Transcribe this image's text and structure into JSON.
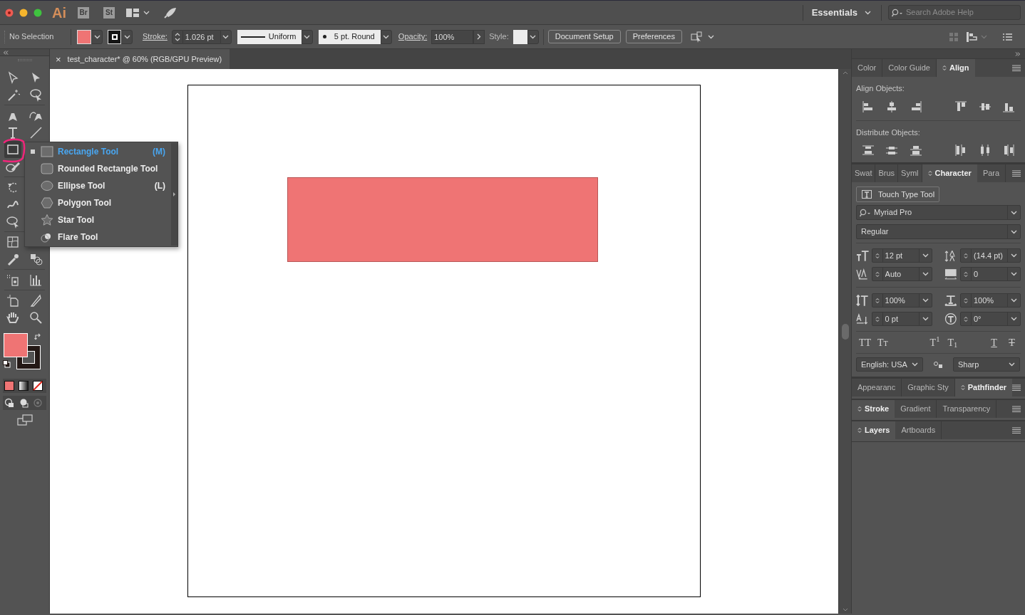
{
  "app_bar": {
    "logo": "Ai",
    "apps": [
      "Br",
      "St"
    ],
    "workspace": "Essentials",
    "search": {
      "placeholder": "Search Adobe Help"
    }
  },
  "control_bar": {
    "selection": "No Selection",
    "stroke_label": "Stroke:",
    "stroke_weight": "1.026 pt",
    "profile": "Uniform",
    "brush": "5 pt. Round",
    "opacity_label": "Opacity:",
    "opacity": "100%",
    "style_label": "Style:",
    "buttons": [
      "Document Setup",
      "Preferences"
    ]
  },
  "document_tab": {
    "close": "×",
    "title": "test_character* @ 60% (RGB/GPU Preview)"
  },
  "tool_flyout": {
    "items": [
      {
        "kind": "rectangle",
        "label": "Rectangle Tool",
        "shortcut": "(M)",
        "selected": true
      },
      {
        "kind": "rounded-rectangle",
        "label": "Rounded Rectangle Tool",
        "selected": false
      },
      {
        "kind": "ellipse",
        "label": "Ellipse Tool",
        "shortcut": "(L)",
        "selected": false
      },
      {
        "kind": "polygon",
        "label": "Polygon Tool",
        "selected": false
      },
      {
        "kind": "star",
        "label": "Star Tool",
        "selected": false
      },
      {
        "kind": "flare",
        "label": "Flare Tool",
        "selected": false
      }
    ]
  },
  "panels": [
    {
      "kind": "align",
      "tabs": [
        {
          "label": "Color",
          "selected": false
        },
        {
          "label": "Color Guide",
          "selected": false
        },
        {
          "label": "Align",
          "selected": true
        }
      ],
      "align_label": "Align Objects:",
      "distribute_label": "Distribute Objects:"
    },
    {
      "kind": "character",
      "tabs": [
        {
          "label": "Swat",
          "selected": false
        },
        {
          "label": "Brus",
          "selected": false
        },
        {
          "label": "Syml",
          "selected": false
        },
        {
          "label": "Character",
          "selected": true
        },
        {
          "label": "Para",
          "selected": false
        }
      ],
      "touch_type": "Touch Type Tool",
      "font": "Myriad Pro",
      "font_style": "Regular",
      "fields": [
        {
          "value": "12 pt"
        },
        {
          "value": "(14.4 pt)"
        },
        {
          "value": "Auto"
        },
        {
          "value": "0"
        },
        {
          "value": "100%"
        },
        {
          "value": "100%"
        },
        {
          "value": "0 pt"
        },
        {
          "value": "0°"
        }
      ],
      "type_styles": [
        {
          "kind": "all-caps",
          "label": "TT"
        },
        {
          "kind": "small-caps",
          "label": "Tт"
        },
        {
          "kind": "superscript",
          "label": "T$^{1}$"
        },
        {
          "kind": "subscript",
          "label": "T$_{1}$"
        },
        {
          "kind": "underline",
          "label": "T"
        },
        {
          "kind": "strikethrough",
          "label": "T"
        }
      ],
      "language": "English: USA",
      "antialias": "Sharp"
    },
    {
      "kind": "tabs-only",
      "tabs": [
        {
          "label": "Appearanc",
          "selected": false
        },
        {
          "label": "Graphic Sty",
          "selected": false
        },
        {
          "label": "Pathfinder",
          "selected": true
        }
      ]
    },
    {
      "kind": "tabs-only",
      "tabs": [
        {
          "label": "Stroke",
          "selected": true
        },
        {
          "label": "Gradient",
          "selected": false
        },
        {
          "label": "Transparency",
          "selected": false
        }
      ]
    },
    {
      "kind": "tabs-only",
      "tabs": [
        {
          "label": "Layers",
          "selected": true
        },
        {
          "label": "Artboards",
          "selected": false
        }
      ]
    }
  ]
}
